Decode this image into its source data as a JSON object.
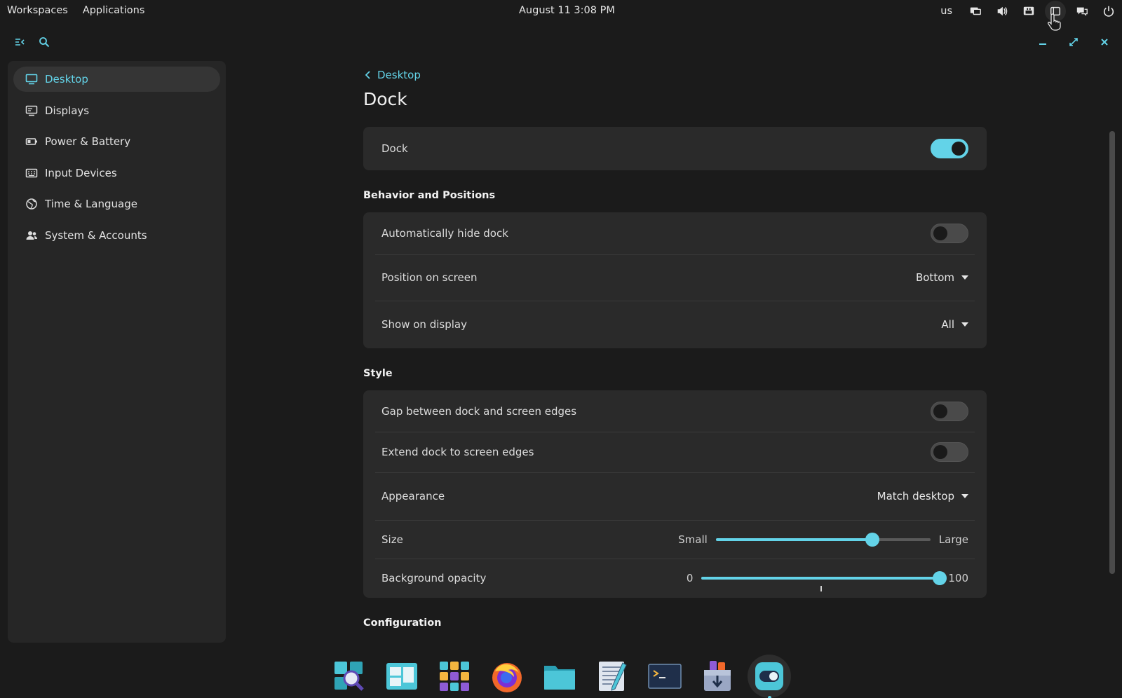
{
  "top_panel": {
    "workspaces": "Workspaces",
    "applications": "Applications",
    "clock": "August 11 3:08 PM",
    "keyboard_layout": "us",
    "tray_icons": [
      "display-icon",
      "volume-icon",
      "network-icon",
      "notifications-icon",
      "chat-icon",
      "power-icon"
    ]
  },
  "window_controls": [
    "minimize",
    "maximize",
    "close"
  ],
  "sidebar": {
    "items": [
      {
        "label": "Desktop",
        "icon": "desktop-icon",
        "active": true
      },
      {
        "label": "Displays",
        "icon": "displays-icon",
        "active": false
      },
      {
        "label": "Power & Battery",
        "icon": "battery-icon",
        "active": false
      },
      {
        "label": "Input Devices",
        "icon": "keyboard-icon",
        "active": false
      },
      {
        "label": "Time & Language",
        "icon": "globe-icon",
        "active": false
      },
      {
        "label": "System & Accounts",
        "icon": "users-icon",
        "active": false
      }
    ]
  },
  "content": {
    "back_label": "Desktop",
    "title": "Dock",
    "dock_row": {
      "label": "Dock",
      "enabled": true
    },
    "behavior": {
      "title": "Behavior and Positions",
      "auto_hide": {
        "label": "Automatically hide dock",
        "enabled": false
      },
      "position": {
        "label": "Position on screen",
        "value": "Bottom"
      },
      "show_on_display": {
        "label": "Show on display",
        "value": "All"
      }
    },
    "style": {
      "title": "Style",
      "gap": {
        "label": "Gap between dock and screen edges",
        "enabled": false
      },
      "extend": {
        "label": "Extend dock to screen edges",
        "enabled": false
      },
      "appearance": {
        "label": "Appearance",
        "value": "Match desktop"
      },
      "size": {
        "label": "Size",
        "min_label": "Small",
        "max_label": "Large",
        "value_fraction": 0.73
      },
      "opacity": {
        "label": "Background opacity",
        "min_label": "0",
        "max_label": "100",
        "value": 100,
        "mark_fraction": 0.5
      }
    },
    "configuration": {
      "title": "Configuration"
    }
  },
  "dock": {
    "apps": [
      "app-search",
      "workspaces",
      "app-library",
      "firefox",
      "files",
      "text-editor",
      "terminal",
      "app-store",
      "settings"
    ],
    "active_app": "settings"
  },
  "colors": {
    "accent": "#63d3e8",
    "background": "#1b1b1b",
    "card": "#2a2a2a",
    "sidebar": "#262626"
  }
}
